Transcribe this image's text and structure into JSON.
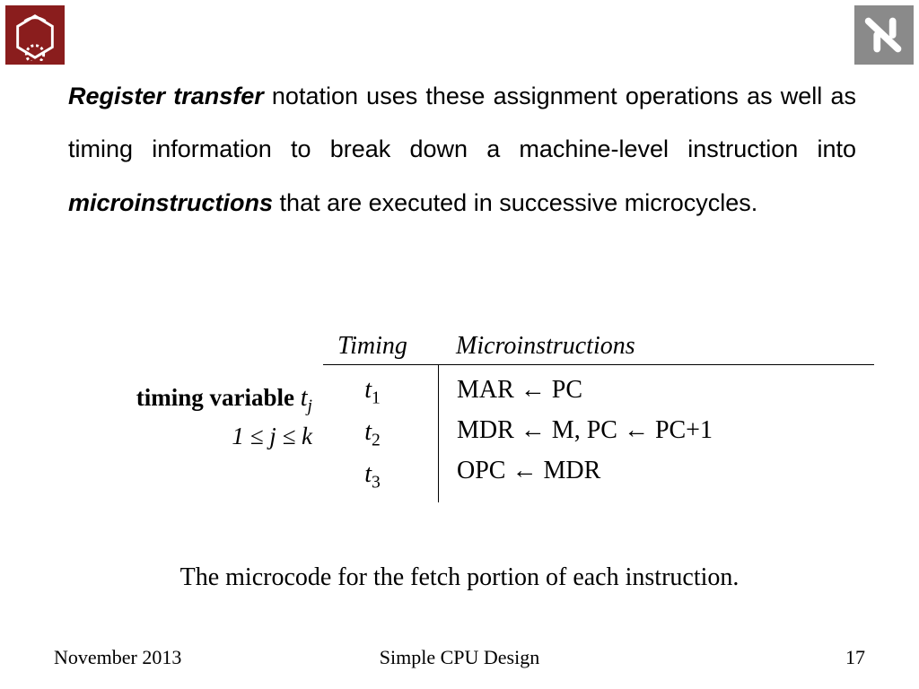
{
  "paragraph": {
    "lead": "Register transfer",
    "mid": " notation uses these assignment operations as well as timing information to break down a machine-level instruction into ",
    "bold2": "microinstructions",
    "tail": " that are executed in successive microcycles."
  },
  "table": {
    "side_label": "timing variable ",
    "side_var": "t",
    "side_sub": "j",
    "range": "1 ≤ j ≤ k",
    "head_timing": "Timing",
    "head_micro": "Microinstructions",
    "t1": "t",
    "t1s": "1",
    "t2": "t",
    "t2s": "2",
    "t3": "t",
    "t3s": "3",
    "m1": "MAR ← PC",
    "m2": "MDR ← M, PC ← PC+1",
    "m3": "OPC ← MDR"
  },
  "caption": "The microcode for the fetch portion of each instruction.",
  "footer": {
    "left": "November 2013",
    "center": "Simple CPU Design",
    "right": "17"
  }
}
